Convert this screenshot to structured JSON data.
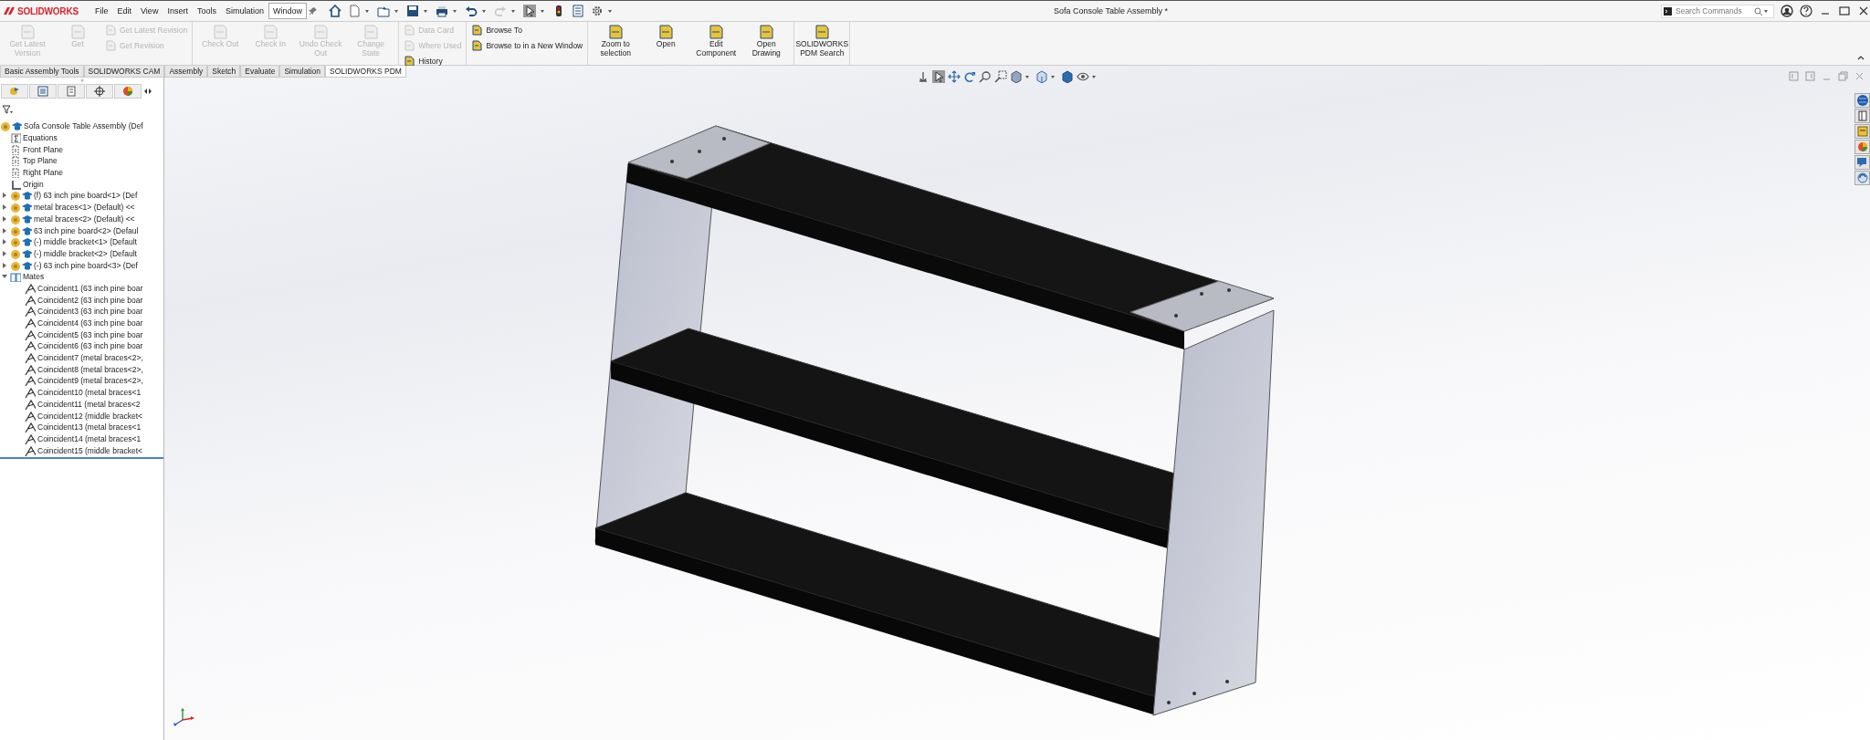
{
  "app": {
    "logo": "SOLIDWORKS"
  },
  "menu": [
    {
      "label": "File",
      "selected": false
    },
    {
      "label": "Edit",
      "selected": false
    },
    {
      "label": "View",
      "selected": false
    },
    {
      "label": "Insert",
      "selected": false
    },
    {
      "label": "Tools",
      "selected": false
    },
    {
      "label": "Simulation",
      "selected": false
    },
    {
      "label": "Window",
      "selected": true
    }
  ],
  "window": {
    "title": "Sofa Console Table Assembly *"
  },
  "search": {
    "placeholder": "Search Commands"
  },
  "ribbon": {
    "groups": [
      {
        "items": [
          {
            "label": "Get Latest Version",
            "kind": "large",
            "disabled": true
          },
          {
            "label": "Get",
            "kind": "large",
            "disabled": true
          },
          {
            "label": "Get Latest Revision",
            "kind": "small",
            "disabled": true
          },
          {
            "label": "Get Revision",
            "kind": "small",
            "disabled": true
          }
        ]
      },
      {
        "items": [
          {
            "label": "Check Out",
            "kind": "large",
            "disabled": true
          },
          {
            "label": "Check In",
            "kind": "large",
            "disabled": true
          },
          {
            "label": "Undo Check Out",
            "kind": "large",
            "disabled": true
          },
          {
            "label": "Change State",
            "kind": "large",
            "disabled": true
          }
        ]
      },
      {
        "items": [
          {
            "label": "Data Card",
            "kind": "small",
            "disabled": true
          },
          {
            "label": "Where Used",
            "kind": "small",
            "disabled": true
          },
          {
            "label": "History",
            "kind": "small",
            "disabled": false
          }
        ]
      },
      {
        "items": [
          {
            "label": "Browse To",
            "kind": "small",
            "disabled": false
          },
          {
            "label": "Browse to in a New Window",
            "kind": "small",
            "disabled": false
          }
        ]
      },
      {
        "items": [
          {
            "label": "Zoom to selection",
            "kind": "large",
            "disabled": false
          },
          {
            "label": "Open",
            "kind": "large",
            "disabled": false
          },
          {
            "label": "Edit Component",
            "kind": "large",
            "disabled": false
          },
          {
            "label": "Open Drawing",
            "kind": "large",
            "disabled": false
          }
        ]
      },
      {
        "items": [
          {
            "label": "SOLIDWORKS PDM Search",
            "kind": "large",
            "disabled": false
          }
        ]
      }
    ]
  },
  "tabs": [
    {
      "label": "Basic Assembly Tools",
      "selected": false
    },
    {
      "label": "SOLIDWORKS CAM",
      "selected": false
    },
    {
      "label": "Assembly",
      "selected": false
    },
    {
      "label": "Sketch",
      "selected": false
    },
    {
      "label": "Evaluate",
      "selected": false
    },
    {
      "label": "Simulation",
      "selected": false
    },
    {
      "label": "SOLIDWORKS PDM",
      "selected": true
    }
  ],
  "tree": {
    "root": {
      "label": "Sofa Console Table Assembly (Def",
      "kind": "assembly",
      "children": [
        {
          "label": "Equations",
          "kind": "equations"
        },
        {
          "label": "Front Plane",
          "kind": "plane"
        },
        {
          "label": "Top Plane",
          "kind": "plane"
        },
        {
          "label": "Right Plane",
          "kind": "plane"
        },
        {
          "label": "Origin",
          "kind": "origin"
        },
        {
          "label": "(f) 63 inch pine board<1> (Def",
          "kind": "part",
          "expanded": false
        },
        {
          "label": "metal braces<1> (Default) <<",
          "kind": "part",
          "expanded": false
        },
        {
          "label": "metal braces<2> (Default) <<",
          "kind": "part",
          "expanded": false
        },
        {
          "label": "63 inch pine board<2> (Defaul",
          "kind": "part",
          "expanded": false
        },
        {
          "label": "(-) middle bracket<1> (Default",
          "kind": "part",
          "expanded": false
        },
        {
          "label": "(-) middle bracket<2> (Default",
          "kind": "part",
          "expanded": false
        },
        {
          "label": "(-) 63 inch pine board<3> (Def",
          "kind": "part",
          "expanded": false
        },
        {
          "label": "Mates",
          "kind": "mates",
          "expanded": true,
          "children": [
            {
              "label": "Coincident1 (63 inch pine boar",
              "kind": "mate"
            },
            {
              "label": "Coincident2 (63 inch pine boar",
              "kind": "mate"
            },
            {
              "label": "Coincident3 (63 inch pine boar",
              "kind": "mate"
            },
            {
              "label": "Coincident4 (63 inch pine boar",
              "kind": "mate"
            },
            {
              "label": "Coincident5 (63 inch pine boar",
              "kind": "mate"
            },
            {
              "label": "Coincident6 (63 inch pine boar",
              "kind": "mate"
            },
            {
              "label": "Coincident7 (metal braces<2>,",
              "kind": "mate"
            },
            {
              "label": "Coincident8 (metal braces<2>,",
              "kind": "mate"
            },
            {
              "label": "Coincident9 (metal braces<2>,",
              "kind": "mate"
            },
            {
              "label": "Coincident10 (metal braces<1",
              "kind": "mate"
            },
            {
              "label": "Coincident11 (metal braces<2",
              "kind": "mate"
            },
            {
              "label": "Coincident12 (middle bracket<",
              "kind": "mate"
            },
            {
              "label": "Coincident13 (metal braces<1",
              "kind": "mate"
            },
            {
              "label": "Coincident14 (metal braces<1",
              "kind": "mate"
            },
            {
              "label": "Coincident15 (middle bracket<",
              "kind": "mate"
            }
          ]
        }
      ]
    }
  }
}
